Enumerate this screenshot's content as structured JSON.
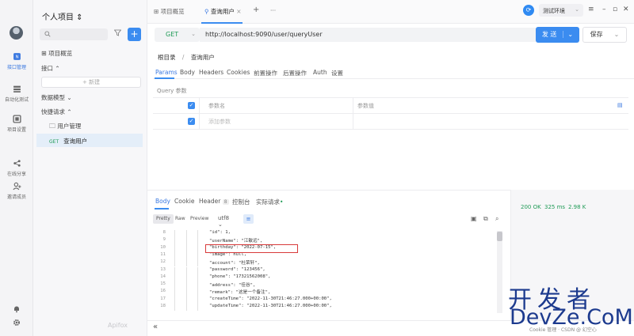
{
  "rail": {
    "items": [
      {
        "label": "接口管理",
        "icon": "api-icon"
      },
      {
        "label": "自动化测试",
        "icon": "test-icon"
      },
      {
        "label": "项目设置",
        "icon": "settings-icon"
      },
      {
        "label": "在线分享",
        "icon": "share-icon"
      },
      {
        "label": "邀请成员",
        "icon": "invite-icon"
      }
    ]
  },
  "sidebar": {
    "project_title": "个人项目 ⇕",
    "overview": "项目概览",
    "api_section": "接口 ⌃",
    "new_button": "+ 新建",
    "models": "数据模型 ⌄",
    "quick_requests": "快捷请求 ⌃",
    "folder": "用户管理",
    "request_method": "GET",
    "request_name": "查询用户",
    "logo": "Apifox"
  },
  "topbar": {
    "tab1": "项目概览",
    "tab2": "查询用户",
    "plus": "+",
    "more": "···",
    "env": "测试环境",
    "env_chevron": "⌄"
  },
  "request": {
    "method": "GET",
    "url": "http://localhost:9090/user/queryUser",
    "send": "发 送",
    "save": "保存"
  },
  "breadcrumb": {
    "root": "根目录",
    "sep": "/",
    "current": "查询用户"
  },
  "subtabs": [
    "Params",
    "Body",
    "Headers",
    "Cookies",
    "前置操作",
    "后置操作",
    "Auth",
    "设置"
  ],
  "query": {
    "label": "Query 参数",
    "col_name": "参数名",
    "col_value": "参数值",
    "add_placeholder": "添加参数"
  },
  "response": {
    "tabs": [
      "Body",
      "Cookie",
      "Header",
      "控制台",
      "实际请求"
    ],
    "header_count": "8",
    "formats": [
      "Pretty",
      "Raw",
      "Preview"
    ],
    "encoding": "utf8 ⌄",
    "status": "200 OK",
    "time": "325 ms",
    "size": "2.98 K",
    "collapse": "«",
    "lines": [
      {
        "n": "8",
        "t": "\"id\": 1,"
      },
      {
        "n": "9",
        "t": "\"userName\": \"江敏远\","
      },
      {
        "n": "10",
        "t": "\"birthday\": \"2022-07-15\","
      },
      {
        "n": "11",
        "t": "\"image\": null,"
      },
      {
        "n": "12",
        "t": "\"account\": \"杜荣轩\","
      },
      {
        "n": "13",
        "t": "\"password\": \"123456\","
      },
      {
        "n": "14",
        "t": "\"phone\": \"17321562008\","
      },
      {
        "n": "15",
        "t": "\"address\": \"佳谷\","
      },
      {
        "n": "16",
        "t": "\"remark\": \"这是一个备注\","
      },
      {
        "n": "17",
        "t": "\"createTime\": \"2022-11-30T21:46:27.000+00:00\","
      },
      {
        "n": "18",
        "t": "\"updateTime\": \"2022-11-30T21:46:27.000+00:00\","
      }
    ]
  },
  "watermark": {
    "line1": "开发者",
    "line2": "DevZe.CoM",
    "credit": "Cookie 管理 · CSDN @ 幻空心"
  },
  "colors": {
    "accent": "#3b8cf0",
    "get": "#1f9b56",
    "highlight_box": "#d83a3a",
    "watermark": "#1c3a8e"
  }
}
